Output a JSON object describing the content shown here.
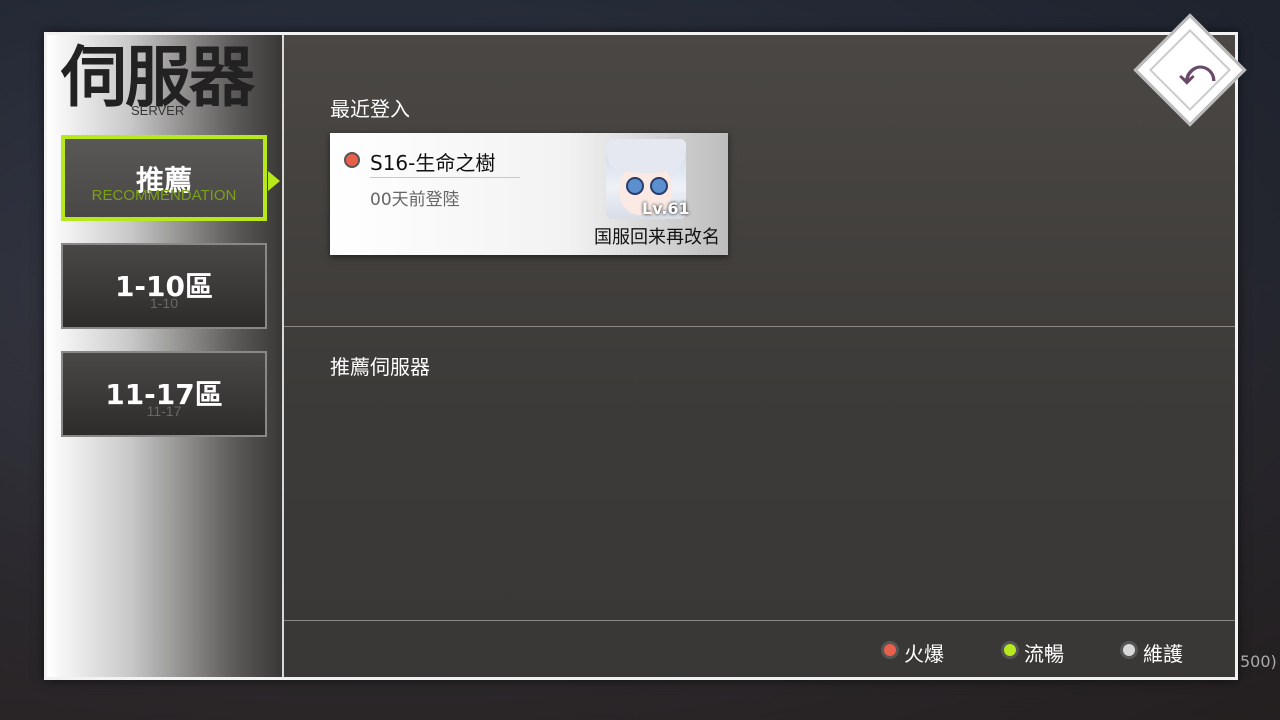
{
  "sidebar": {
    "title": "伺服器",
    "subtitle": "SERVER",
    "tabs": [
      {
        "label": "推薦",
        "sub": "RECOMMENDATION",
        "active": true
      },
      {
        "label": "1-10區",
        "sub": "1-10",
        "active": false
      },
      {
        "label": "11-17區",
        "sub": "11-17",
        "active": false
      }
    ]
  },
  "recent": {
    "section_title": "最近登入",
    "server": {
      "name": "S16-生命之樹",
      "status_color": "#e8604c",
      "last_login": "00天前登陸",
      "level": "Lv.61",
      "nickname": "国服回来再改名",
      "avatar_icon": "character-portrait"
    }
  },
  "recommended": {
    "section_title": "推薦伺服器"
  },
  "legend": [
    {
      "label": "火爆",
      "color": "#e8604c"
    },
    {
      "label": "流暢",
      "color": "#b6e81c"
    },
    {
      "label": "維護",
      "color": "#d8d8d8"
    }
  ],
  "back_icon": "back-arrow",
  "edge_text": "500)",
  "colors": {
    "accent": "#b6e81c",
    "panel_border": "#f2f2f2"
  }
}
